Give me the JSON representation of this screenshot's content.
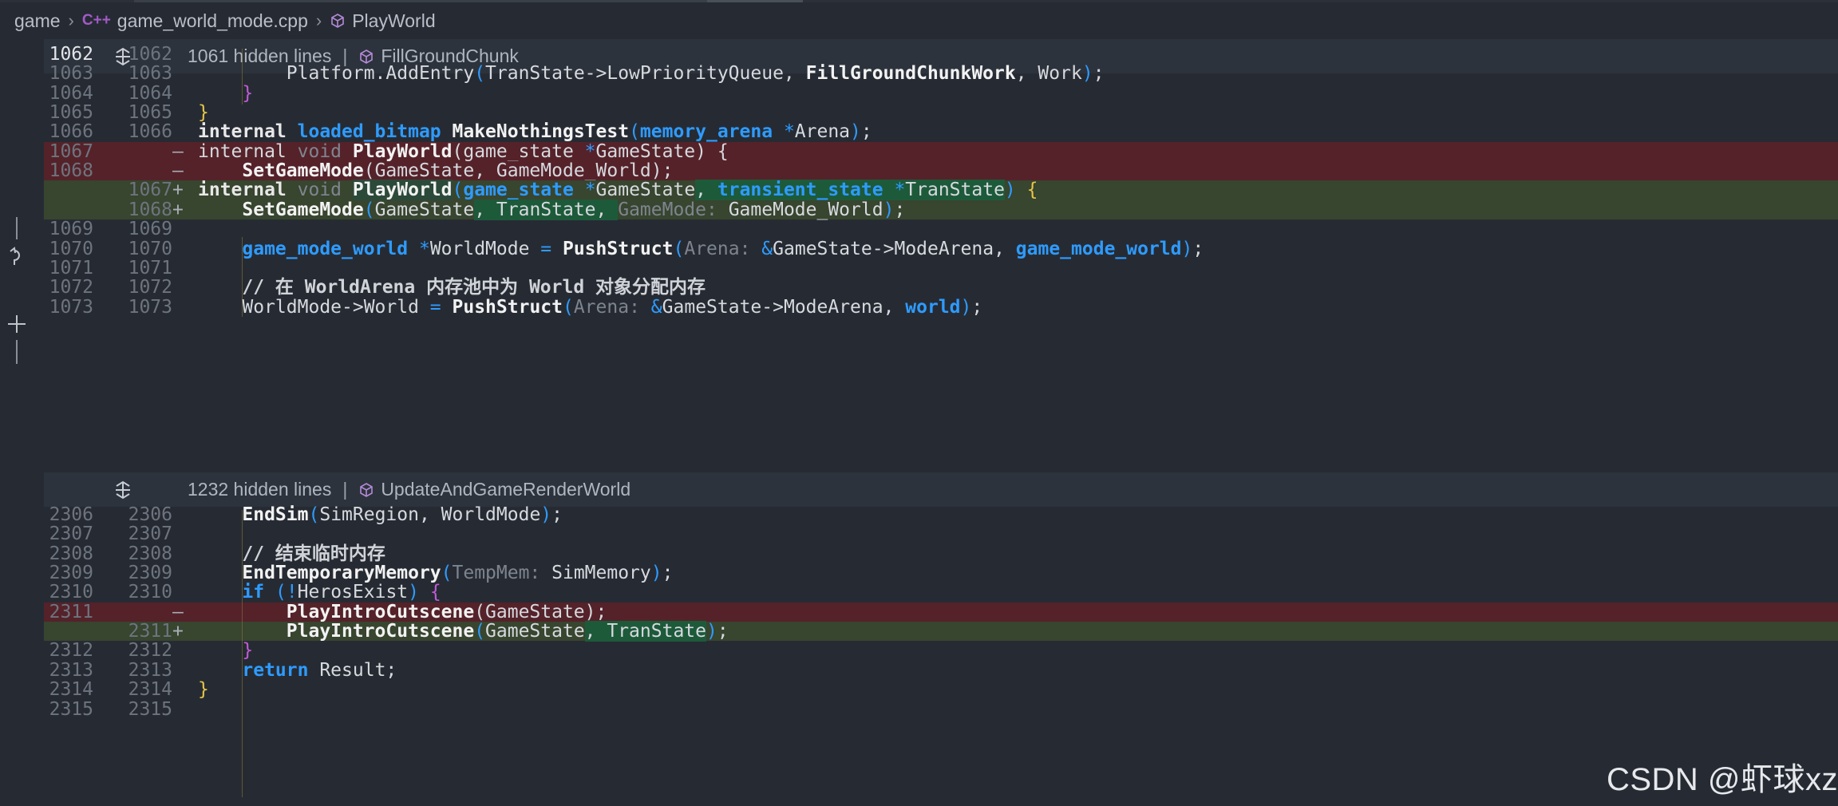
{
  "breadcrumb": {
    "items": [
      "game",
      "game_world_mode.cpp",
      "PlayWorld"
    ],
    "lang_badge": "C++"
  },
  "folds": [
    {
      "hidden": "1061 hidden lines",
      "sep": "|",
      "symbol": "FillGroundChunk"
    },
    {
      "hidden": "1232 hidden lines",
      "sep": "|",
      "symbol": "UpdateAndGameRenderWorld"
    }
  ],
  "lines": [
    {
      "n1": "1062",
      "n2": "1062",
      "mk": "",
      "type": "ctx",
      "cur": true,
      "tokens": []
    },
    {
      "n1": "1063",
      "n2": "1063",
      "mk": "",
      "type": "ctx",
      "tokens": [
        {
          "t": "        Platform.AddEntry",
          "c": "t-fnlight"
        },
        {
          "t": "(",
          "c": "t-paren"
        },
        {
          "t": "TranState->LowPriorityQueue, ",
          "c": "t-punct"
        },
        {
          "t": "FillGroundChunkWork",
          "c": "t-fn"
        },
        {
          "t": ", Work",
          "c": "t-punct"
        },
        {
          "t": ")",
          "c": "t-paren"
        },
        {
          "t": ";",
          "c": "t-punct"
        }
      ]
    },
    {
      "n1": "1064",
      "n2": "1064",
      "mk": "",
      "type": "ctx",
      "tokens": [
        {
          "t": "    }",
          "c": "t-brace2"
        }
      ]
    },
    {
      "n1": "1065",
      "n2": "1065",
      "mk": "",
      "type": "ctx",
      "tokens": [
        {
          "t": "}",
          "c": "t-brace"
        }
      ]
    },
    {
      "n1": "1066",
      "n2": "1066",
      "mk": "",
      "type": "ctx",
      "tokens": [
        {
          "t": "internal ",
          "c": "t-kw"
        },
        {
          "t": "loaded_bitmap",
          "c": "t-type"
        },
        {
          "t": " ",
          "c": "t-punct"
        },
        {
          "t": "MakeNothingsTest",
          "c": "t-fn"
        },
        {
          "t": "(",
          "c": "t-paren"
        },
        {
          "t": "memory_arena",
          "c": "t-type"
        },
        {
          "t": " *",
          "c": "t-ptr"
        },
        {
          "t": "Arena",
          "c": "t-punct"
        },
        {
          "t": ")",
          "c": "t-paren"
        },
        {
          "t": ";",
          "c": "t-punct"
        }
      ]
    },
    {
      "n1": "1067",
      "n2": "",
      "mk": "—",
      "type": "del",
      "tokens": [
        {
          "t": "internal ",
          "c": "t-fnlight"
        },
        {
          "t": "void",
          "c": "t-kwdim"
        },
        {
          "t": " ",
          "c": "t-punct"
        },
        {
          "t": "PlayWorld",
          "c": "t-fn"
        },
        {
          "t": "(game_state ",
          "c": "t-punct"
        },
        {
          "t": "*",
          "c": "t-ptr"
        },
        {
          "t": "GameState) {",
          "c": "t-punct"
        }
      ]
    },
    {
      "n1": "1068",
      "n2": "",
      "mk": "—",
      "type": "del",
      "tokens": [
        {
          "t": "    ",
          "c": "t-punct"
        },
        {
          "t": "SetGameMode",
          "c": "t-fn"
        },
        {
          "t": "(GameState, GameMode_World);",
          "c": "t-punct"
        }
      ]
    },
    {
      "n1": "",
      "n2": "1067",
      "mk": "+",
      "type": "add",
      "tokens": [
        {
          "t": "internal ",
          "c": "t-kw"
        },
        {
          "t": "void",
          "c": "t-kwdim"
        },
        {
          "t": " ",
          "c": "t-punct"
        },
        {
          "t": "PlayWorld",
          "c": "t-fn t-hlcur"
        },
        {
          "t": "(",
          "c": "t-paren"
        },
        {
          "t": "game_state",
          "c": "t-type"
        },
        {
          "t": " *",
          "c": "t-ptr"
        },
        {
          "t": "GameState",
          "c": "t-punct"
        },
        {
          "t": ", ",
          "c": "t-punct t-hl"
        },
        {
          "t": "transient_state",
          "c": "t-type t-hl"
        },
        {
          "t": " *",
          "c": "t-ptr t-hl"
        },
        {
          "t": "TranState",
          "c": "t-punct t-hl"
        },
        {
          "t": ")",
          "c": "t-paren"
        },
        {
          "t": " {",
          "c": "t-brace"
        }
      ]
    },
    {
      "n1": "",
      "n2": "1068",
      "mk": "+",
      "type": "add",
      "tokens": [
        {
          "t": "    ",
          "c": "t-punct"
        },
        {
          "t": "SetGameMode",
          "c": "t-fn"
        },
        {
          "t": "(",
          "c": "t-paren"
        },
        {
          "t": "GameState",
          "c": "t-punct"
        },
        {
          "t": ", TranState, ",
          "c": "t-punct t-hl"
        },
        {
          "t": "GameMode: ",
          "c": "t-hint"
        },
        {
          "t": "GameMode_World",
          "c": "t-punct"
        },
        {
          "t": ")",
          "c": "t-paren"
        },
        {
          "t": ";",
          "c": "t-punct"
        }
      ]
    },
    {
      "n1": "1069",
      "n2": "1069",
      "mk": "",
      "type": "ctx",
      "tokens": []
    },
    {
      "n1": "1070",
      "n2": "1070",
      "mk": "",
      "type": "ctx",
      "tokens": [
        {
          "t": "    ",
          "c": "t-punct"
        },
        {
          "t": "game_mode_world",
          "c": "t-type"
        },
        {
          "t": " *",
          "c": "t-ptr"
        },
        {
          "t": "WorldMode ",
          "c": "t-punct"
        },
        {
          "t": "=",
          "c": "t-ptr"
        },
        {
          "t": " ",
          "c": "t-punct"
        },
        {
          "t": "PushStruct",
          "c": "t-fn"
        },
        {
          "t": "(",
          "c": "t-paren"
        },
        {
          "t": "Arena: ",
          "c": "t-hint"
        },
        {
          "t": "&",
          "c": "t-ptr"
        },
        {
          "t": "GameState->ModeArena, ",
          "c": "t-punct"
        },
        {
          "t": "game_mode_world",
          "c": "t-type"
        },
        {
          "t": ")",
          "c": "t-paren"
        },
        {
          "t": ";",
          "c": "t-punct"
        }
      ]
    },
    {
      "n1": "1071",
      "n2": "1071",
      "mk": "",
      "type": "ctx",
      "tokens": []
    },
    {
      "n1": "1072",
      "n2": "1072",
      "mk": "",
      "type": "ctx",
      "tokens": [
        {
          "t": "    // 在 WorldArena 内存池中为 World 对象分配内存",
          "c": "t-cmt"
        }
      ]
    },
    {
      "n1": "1073",
      "n2": "1073",
      "mk": "",
      "type": "ctx",
      "tokens": [
        {
          "t": "    WorldMode->World ",
          "c": "t-punct"
        },
        {
          "t": "=",
          "c": "t-ptr"
        },
        {
          "t": " ",
          "c": "t-punct"
        },
        {
          "t": "PushStruct",
          "c": "t-fn"
        },
        {
          "t": "(",
          "c": "t-paren"
        },
        {
          "t": "Arena: ",
          "c": "t-hint"
        },
        {
          "t": "&",
          "c": "t-ptr"
        },
        {
          "t": "GameState->ModeArena, ",
          "c": "t-punct"
        },
        {
          "t": "world",
          "c": "t-type"
        },
        {
          "t": ")",
          "c": "t-paren"
        },
        {
          "t": ";",
          "c": "t-punct"
        }
      ]
    },
    {
      "n1": "2306",
      "n2": "2306",
      "mk": "",
      "type": "ctx",
      "tokens": [
        {
          "t": "    ",
          "c": "t-punct"
        },
        {
          "t": "EndSim",
          "c": "t-fn"
        },
        {
          "t": "(",
          "c": "t-paren"
        },
        {
          "t": "SimRegion, WorldMode",
          "c": "t-punct"
        },
        {
          "t": ")",
          "c": "t-paren"
        },
        {
          "t": ";",
          "c": "t-punct"
        }
      ]
    },
    {
      "n1": "2307",
      "n2": "2307",
      "mk": "",
      "type": "ctx",
      "tokens": []
    },
    {
      "n1": "2308",
      "n2": "2308",
      "mk": "",
      "type": "ctx",
      "tokens": [
        {
          "t": "    // 结束临时内存",
          "c": "t-cmt"
        }
      ]
    },
    {
      "n1": "2309",
      "n2": "2309",
      "mk": "",
      "type": "ctx",
      "tokens": [
        {
          "t": "    ",
          "c": "t-punct"
        },
        {
          "t": "EndTemporaryMemory",
          "c": "t-fn"
        },
        {
          "t": "(",
          "c": "t-paren"
        },
        {
          "t": "TempMem: ",
          "c": "t-hint"
        },
        {
          "t": "SimMemory",
          "c": "t-punct"
        },
        {
          "t": ")",
          "c": "t-paren"
        },
        {
          "t": ";",
          "c": "t-punct"
        }
      ]
    },
    {
      "n1": "2310",
      "n2": "2310",
      "mk": "",
      "type": "ctx",
      "tokens": [
        {
          "t": "    ",
          "c": "t-punct"
        },
        {
          "t": "if",
          "c": "t-ret"
        },
        {
          "t": " ",
          "c": "t-punct"
        },
        {
          "t": "(",
          "c": "t-paren"
        },
        {
          "t": "!",
          "c": "t-ptr"
        },
        {
          "t": "HerosExist",
          "c": "t-punct"
        },
        {
          "t": ")",
          "c": "t-paren"
        },
        {
          "t": " {",
          "c": "t-brace2"
        }
      ]
    },
    {
      "n1": "2311",
      "n2": "",
      "mk": "—",
      "type": "del",
      "tokens": [
        {
          "t": "        ",
          "c": "t-punct"
        },
        {
          "t": "PlayIntroCutscene",
          "c": "t-fn"
        },
        {
          "t": "(GameState);",
          "c": "t-punct"
        }
      ]
    },
    {
      "n1": "",
      "n2": "2311",
      "mk": "+",
      "type": "add",
      "tokens": [
        {
          "t": "        ",
          "c": "t-punct"
        },
        {
          "t": "PlayIntroCutscene",
          "c": "t-fn"
        },
        {
          "t": "(",
          "c": "t-paren"
        },
        {
          "t": "GameState",
          "c": "t-punct"
        },
        {
          "t": ", TranState",
          "c": "t-punct t-hl"
        },
        {
          "t": ")",
          "c": "t-paren"
        },
        {
          "t": ";",
          "c": "t-punct"
        }
      ]
    },
    {
      "n1": "2312",
      "n2": "2312",
      "mk": "",
      "type": "ctx",
      "tokens": [
        {
          "t": "    }",
          "c": "t-brace2"
        }
      ]
    },
    {
      "n1": "2313",
      "n2": "2313",
      "mk": "",
      "type": "ctx",
      "tokens": [
        {
          "t": "    ",
          "c": "t-punct"
        },
        {
          "t": "return",
          "c": "t-ret"
        },
        {
          "t": " Result;",
          "c": "t-punct"
        }
      ]
    },
    {
      "n1": "2314",
      "n2": "2314",
      "mk": "",
      "type": "ctx",
      "tokens": [
        {
          "t": "}",
          "c": "t-brace"
        }
      ]
    },
    {
      "n1": "2315",
      "n2": "2315",
      "mk": "",
      "type": "ctx",
      "tokens": []
    }
  ],
  "watermark": "CSDN @虾球xz"
}
